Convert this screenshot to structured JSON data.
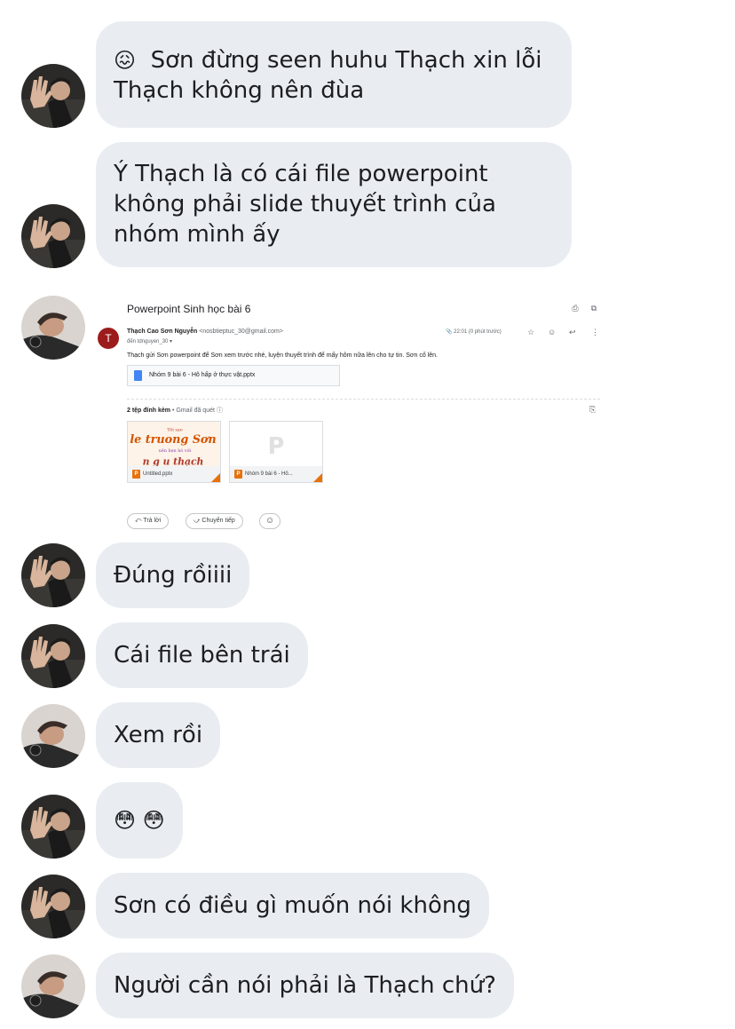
{
  "messages": [
    {
      "lines": [
        "Sơn đừng seen huhu Thạch xin lỗi",
        "Thạch không nên đùa"
      ],
      "emoji_prefix": "😖"
    },
    {
      "lines": [
        "Ý Thạch là có cái file powerpoint",
        "không phải slide thuyết trình của",
        "nhóm mình ấy"
      ]
    },
    {
      "lines": [
        "Đúng rồiiii"
      ]
    },
    {
      "lines": [
        "Cái file bên trái"
      ]
    },
    {
      "lines": [
        "Xem rồi"
      ]
    },
    {
      "lines": [
        "😳 😳"
      ]
    },
    {
      "lines": [
        "Sơn có điều gì muốn nói không"
      ]
    },
    {
      "lines": [
        "Người cần nói phải là Thạch chứ?"
      ]
    }
  ],
  "email": {
    "subject": "Powerpoint Sinh học bài 6",
    "sender_initial": "T",
    "sender_name": "Thạch Cao Sơn Nguyễn",
    "sender_email": "<nosbtieptuc_30@gmail.com>",
    "recipient": "đến tdnguyen_30 ▾",
    "time": "22:01 (0 phút trước)",
    "body": "Thạch gửi Sơn powerpoint để Sơn xem trước nhé, luyện thuyết trình để mấy hôm nữa lên cho tự tin. Sơn cố lên.",
    "inline_file": "Nhóm 9 bài 6 - Hô hấp ở thực vật.pptx",
    "attachments_count": "2 tệp đính kèm",
    "attachments_scan": " • Gmail đã quét ⓘ",
    "attachments": [
      {
        "name": "Untitled.pptx",
        "thumb_lines": [
          "Tôi sao",
          "le truong Sơn",
          "nên hẹn hò với",
          "n g u thạch"
        ]
      },
      {
        "name": "Nhóm 9 bài 6 - Hô...",
        "thumb_letter": "P"
      }
    ],
    "reply_label": "⤺  Trả lời",
    "forward_label": "⤻  Chuyển tiếp",
    "emoji_reaction_icon": "☺"
  },
  "icons": {
    "print": "⎙",
    "open_new": "⧉",
    "attach": "📎",
    "star": "☆",
    "emoji": "☺",
    "reply": "↩",
    "more": "⋮",
    "add_to_drive": "⎘"
  }
}
